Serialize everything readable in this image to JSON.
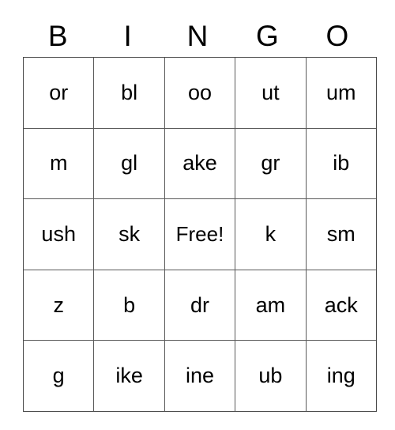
{
  "card": {
    "title_letters": [
      "B",
      "I",
      "N",
      "G",
      "O"
    ],
    "free_space_label": "Free!",
    "columns": 5,
    "rows": 5,
    "grid": [
      [
        "or",
        "bl",
        "oo",
        "ut",
        "um"
      ],
      [
        "m",
        "gl",
        "ake",
        "gr",
        "ib"
      ],
      [
        "ush",
        "sk",
        "Free!",
        "k",
        "sm"
      ],
      [
        "z",
        "b",
        "dr",
        "am",
        "ack"
      ],
      [
        "g",
        "ike",
        "ine",
        "ub",
        "ing"
      ]
    ],
    "colors": {
      "background": "#ffffff",
      "text": "#000000",
      "grid_line": "#5a5a5a"
    }
  }
}
